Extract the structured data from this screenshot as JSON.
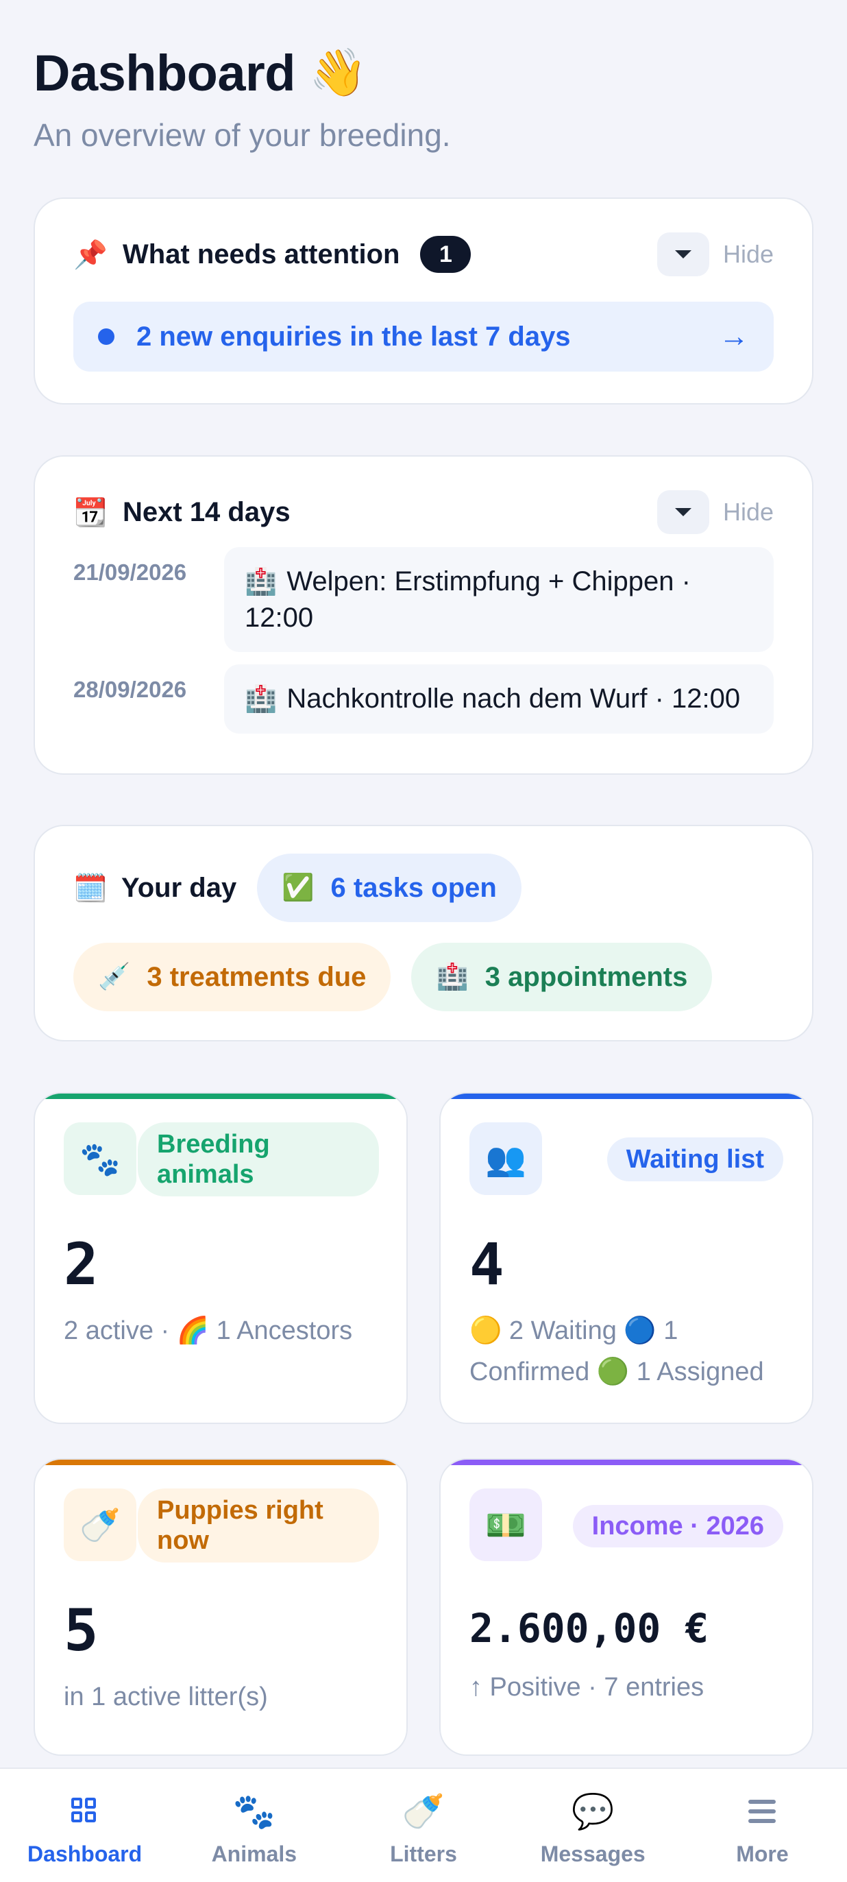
{
  "header": {
    "title": "Dashboard",
    "title_emoji": "👋",
    "subtitle": "An overview of your breeding."
  },
  "attention": {
    "icon": "📌",
    "title": "What needs attention",
    "count": "1",
    "hide_label": "Hide",
    "items": [
      {
        "text": "2 new enquiries in the last 7 days",
        "arrow": "→"
      }
    ]
  },
  "next_days": {
    "icon": "📆",
    "title": "Next 14 days",
    "hide_label": "Hide",
    "events": [
      {
        "date": "21/09/2026",
        "icon": "🏥",
        "text": "Welpen: Erstimpfung + Chippen · 12:00"
      },
      {
        "date": "28/09/2026",
        "icon": "🏥",
        "text": "Nachkontrolle nach dem Wurf · 12:00"
      }
    ]
  },
  "your_day": {
    "icon": "🗓️",
    "title": "Your day",
    "tasks": {
      "icon": "✅",
      "label": "6 tasks open"
    },
    "treatments": {
      "icon": "💉",
      "label": "3 treatments due"
    },
    "appointments": {
      "icon": "🏥",
      "label": "3 appointments"
    }
  },
  "stats": {
    "breeding": {
      "icon": "🐾",
      "tag": "Breeding animals",
      "value": "2",
      "desc": "2 active · 🌈 1 Ancestors",
      "accent": "#16a46e"
    },
    "waiting": {
      "icon": "👥",
      "tag": "Waiting list",
      "value": "4",
      "desc": "🟡 2 Waiting 🔵 1 Confirmed 🟢 1 Assigned",
      "accent": "#2563eb"
    },
    "puppies": {
      "icon": "🍼",
      "tag": "Puppies right now",
      "value": "5",
      "desc": "in 1 active litter(s)",
      "accent": "#d97706"
    },
    "income": {
      "icon": "💵",
      "tag": "Income · 2026",
      "value": "2.600,00 €",
      "desc": "↑ Positive · 7 entries",
      "accent": "#8b5cf6"
    }
  },
  "nav": {
    "dashboard": "Dashboard",
    "animals": "Animals",
    "animals_icon": "🐾",
    "litters": "Litters",
    "litters_icon": "🍼",
    "messages": "Messages",
    "messages_icon": "💬",
    "more": "More"
  }
}
